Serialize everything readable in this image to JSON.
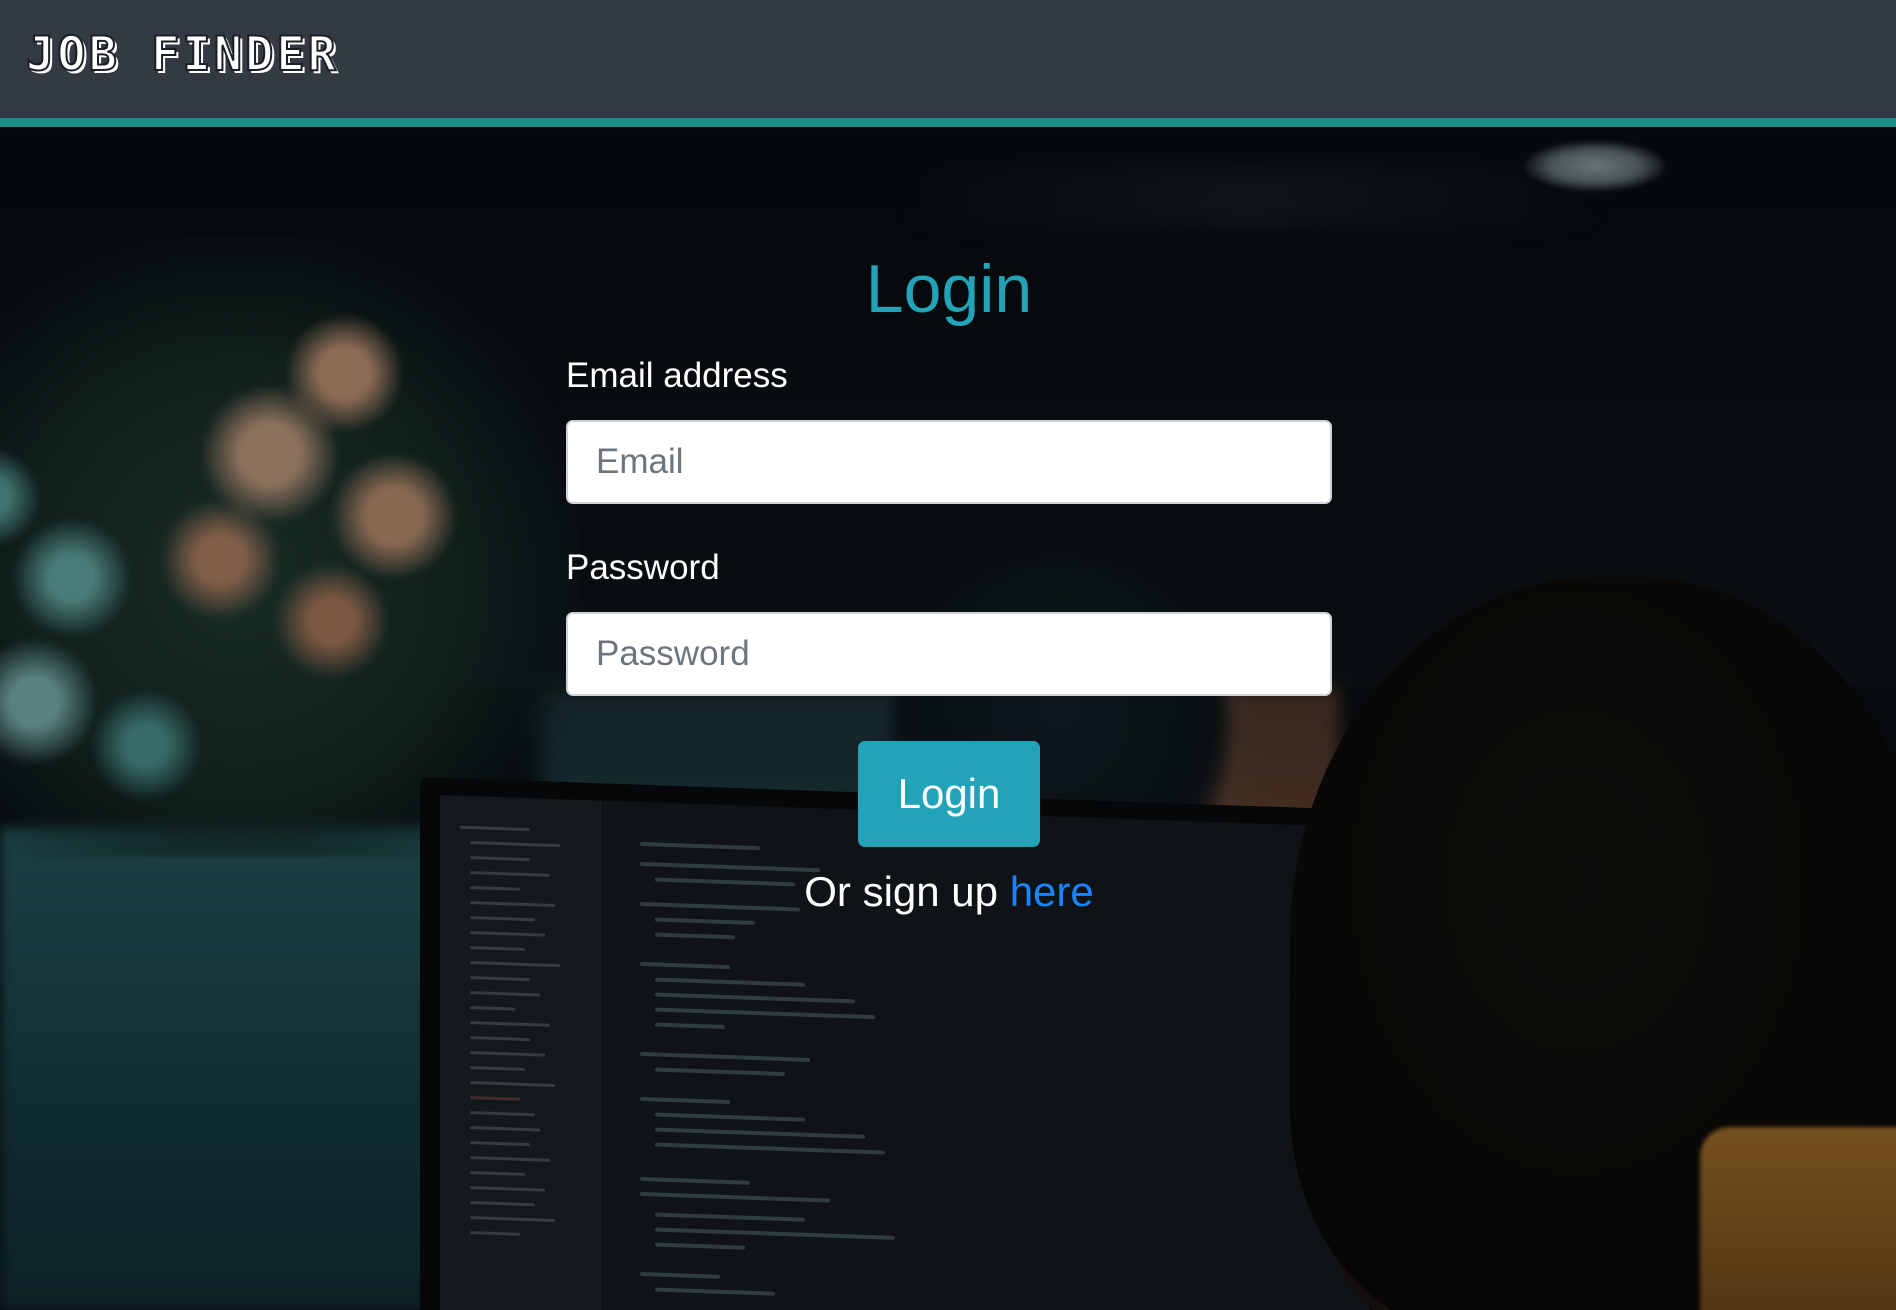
{
  "navbar": {
    "brand": "JOB FINDER",
    "accent_color": "#1a8f8c",
    "background_color": "#343a44"
  },
  "login": {
    "title": "Login",
    "email": {
      "label": "Email address",
      "placeholder": "Email",
      "value": ""
    },
    "password": {
      "label": "Password",
      "placeholder": "Password",
      "value": ""
    },
    "submit_label": "Login",
    "signup_prefix": "Or sign up ",
    "signup_link_text": "here",
    "accent_color": "#23a3b8",
    "link_color": "#1a84ff"
  }
}
